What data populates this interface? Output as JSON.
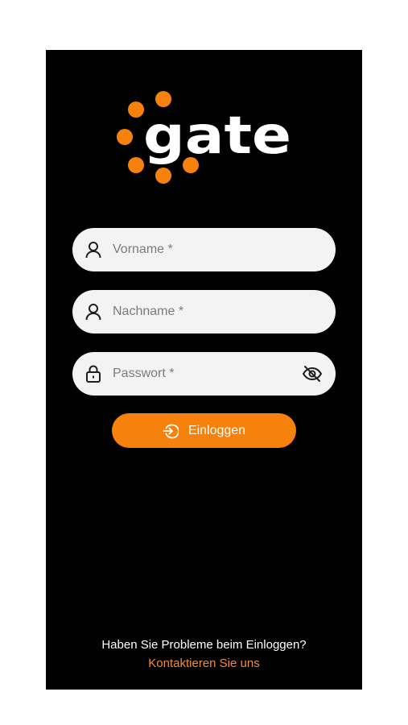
{
  "brand": {
    "name": "gate",
    "accent_color": "#f6820d",
    "background_color": "#000000"
  },
  "form": {
    "first_name": {
      "placeholder": "Vorname *",
      "value": "",
      "icon": "user-icon"
    },
    "last_name": {
      "placeholder": "Nachname *",
      "value": "",
      "icon": "user-icon"
    },
    "password": {
      "placeholder": "Passwort *",
      "value": "",
      "icon": "lock-icon",
      "toggle_icon": "eye-off-icon"
    },
    "submit": {
      "label": "Einloggen",
      "icon": "login-arrow-icon"
    }
  },
  "footer": {
    "help_text": "Haben Sie Probleme beim Einloggen?",
    "contact_link": "Kontaktieren Sie uns",
    "link_color": "#f58a3c"
  }
}
